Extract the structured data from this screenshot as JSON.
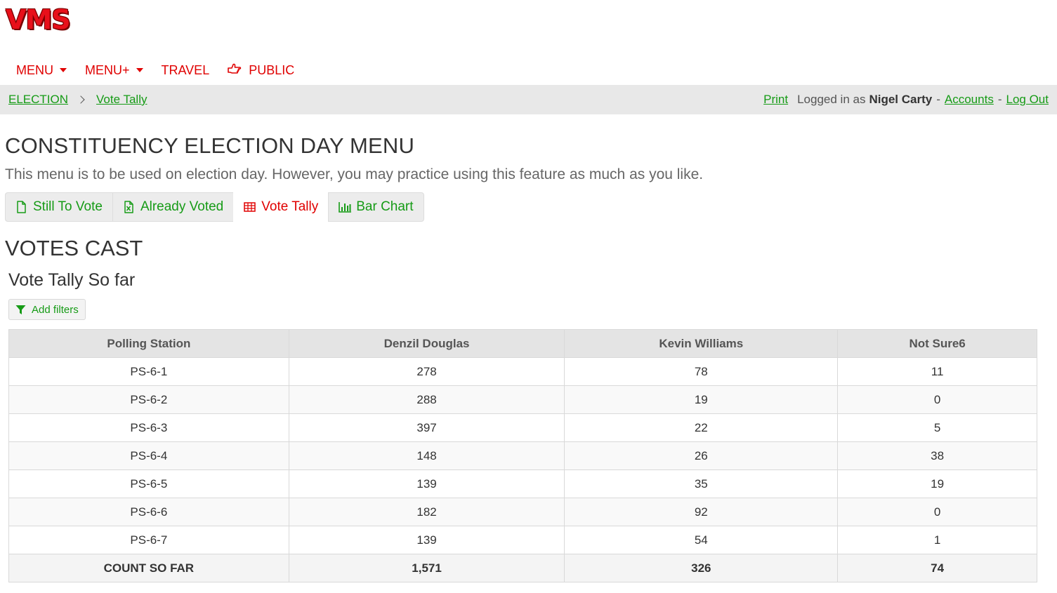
{
  "app": {
    "logo_text": "VMS"
  },
  "nav": {
    "items": [
      {
        "label": "MENU",
        "has_caret": true
      },
      {
        "label": "MENU+",
        "has_caret": true
      },
      {
        "label": "TRAVEL",
        "has_caret": false
      },
      {
        "label": "PUBLIC",
        "icon": "hand-pointing-icon"
      }
    ]
  },
  "breadcrumb": {
    "items": [
      "ELECTION",
      "Vote Tally"
    ]
  },
  "user_bar": {
    "print": "Print",
    "logged_in_prefix": "Logged in as",
    "user_name": "Nigel Carty",
    "separator": "-",
    "accounts": "Accounts",
    "logout": "Log Out"
  },
  "page": {
    "title": "CONSTITUENCY ELECTION DAY MENU",
    "description": "This menu is to be used on election day. However, you may practice using this feature as much as you like."
  },
  "tabs": [
    {
      "label": "Still To Vote",
      "icon": "file-icon",
      "active": false
    },
    {
      "label": "Already Voted",
      "icon": "file-excel-icon",
      "active": false
    },
    {
      "label": "Vote Tally",
      "icon": "table-icon",
      "active": true
    },
    {
      "label": "Bar Chart",
      "icon": "bar-chart-icon",
      "active": false
    }
  ],
  "section": {
    "title": "VOTES CAST",
    "subtitle": "Vote Tally So far",
    "filter_button": "Add filters"
  },
  "table": {
    "headers": [
      "Polling Station",
      "Denzil Douglas",
      "Kevin Williams",
      "Not Sure6"
    ],
    "rows": [
      [
        "PS-6-1",
        "278",
        "78",
        "11"
      ],
      [
        "PS-6-2",
        "288",
        "19",
        "0"
      ],
      [
        "PS-6-3",
        "397",
        "22",
        "5"
      ],
      [
        "PS-6-4",
        "148",
        "26",
        "38"
      ],
      [
        "PS-6-5",
        "139",
        "35",
        "19"
      ],
      [
        "PS-6-6",
        "182",
        "92",
        "0"
      ],
      [
        "PS-6-7",
        "139",
        "54",
        "1"
      ]
    ],
    "total": [
      "COUNT SO FAR",
      "1,571",
      "326",
      "74"
    ]
  },
  "colors": {
    "brand_red": "#e00000",
    "link_green": "#169b16",
    "crumb_bg": "#e8e8e8"
  }
}
